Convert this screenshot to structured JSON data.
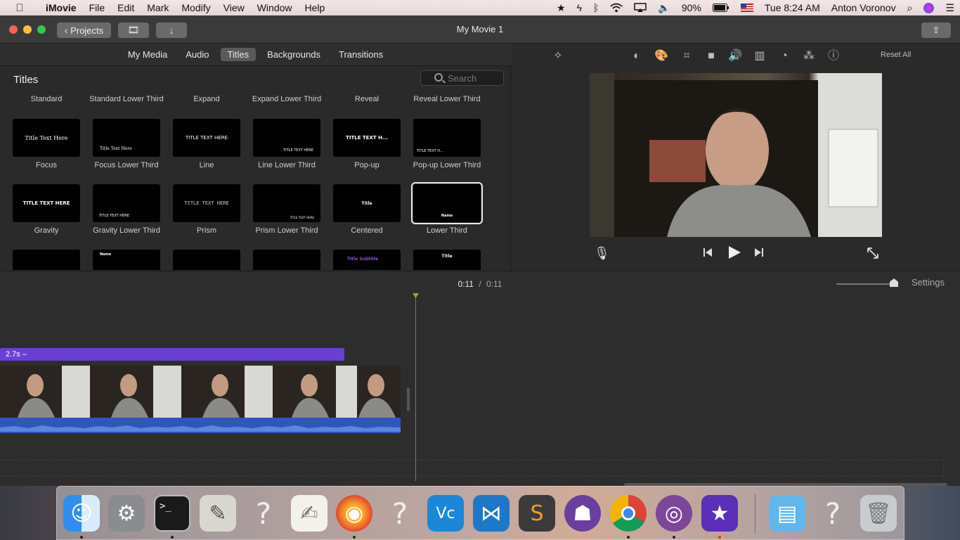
{
  "menubar": {
    "app": "iMovie",
    "items": [
      "File",
      "Edit",
      "Mark",
      "Modify",
      "View",
      "Window",
      "Help"
    ],
    "battery": "90%",
    "clock": "Tue 8:24 AM",
    "user": "Anton Voronov"
  },
  "window": {
    "title": "My Movie 1",
    "projects_button": "Projects"
  },
  "browser": {
    "tabs": [
      "My Media",
      "Audio",
      "Titles",
      "Backgrounds",
      "Transitions"
    ],
    "active_tab": "Titles",
    "section_title": "Titles",
    "search_placeholder": "Search",
    "top_row_labels": [
      "Standard",
      "Standard Lower Third",
      "Expand",
      "Expand Lower Third",
      "Reveal",
      "Reveal Lower Third"
    ],
    "row1": [
      {
        "label": "Focus",
        "thumb": "Title Text Here"
      },
      {
        "label": "Focus Lower Third",
        "thumb": "Title Text Here"
      },
      {
        "label": "Line",
        "thumb": "TITLE TEXT HERE"
      },
      {
        "label": "Line Lower Third",
        "thumb": "TITLE TEXT HERE"
      },
      {
        "label": "Pop-up",
        "thumb": "TITLE TEXT H..."
      },
      {
        "label": "Pop-up Lower Third",
        "thumb": "TITLE TEXT H..."
      }
    ],
    "row2": [
      {
        "label": "Gravity",
        "thumb": "TITLE TEXT HERE"
      },
      {
        "label": "Gravity Lower Third",
        "thumb": "TITLE TEXT HERE"
      },
      {
        "label": "Prism",
        "thumb": "TITLE TEXT HERE"
      },
      {
        "label": "Prism Lower Third",
        "thumb": "TITLE TEXT HERE"
      },
      {
        "label": "Centered",
        "thumb": "Title"
      },
      {
        "label": "Lower Third",
        "thumb": "Name"
      }
    ],
    "row3_thumbs": [
      "",
      "Name",
      "",
      "",
      "Title Subtitle",
      "Title"
    ],
    "selected": "Lower Third"
  },
  "viewer": {
    "reset_label": "Reset All",
    "tool_icons": [
      "magic-wand-icon",
      "color-balance-icon",
      "color-correction-icon",
      "crop-icon",
      "stabilization-icon",
      "volume-icon",
      "noise-reduction-icon",
      "speed-icon",
      "filter-icon",
      "info-icon"
    ]
  },
  "timeline": {
    "current": "0:11",
    "total": "0:11",
    "separator": "/",
    "settings_label": "Settings",
    "title_clip_label": "2.7s –"
  },
  "dock": {
    "apps": [
      "Finder",
      "System Preferences",
      "Terminal",
      "Script Editor",
      "Unknown",
      "TextEdit",
      "Firefox",
      "Unknown",
      "VNC Viewer",
      "Visual Studio Code",
      "Sublime Text",
      "GitHub Desktop",
      "Google Chrome",
      "Tor Browser",
      "iMovie",
      "Downloads",
      "Unknown",
      "Trash"
    ]
  },
  "colors": {
    "title_clip": "#6a3fd6",
    "audio": "#2f56b9",
    "playhead": "#b59a3b"
  }
}
